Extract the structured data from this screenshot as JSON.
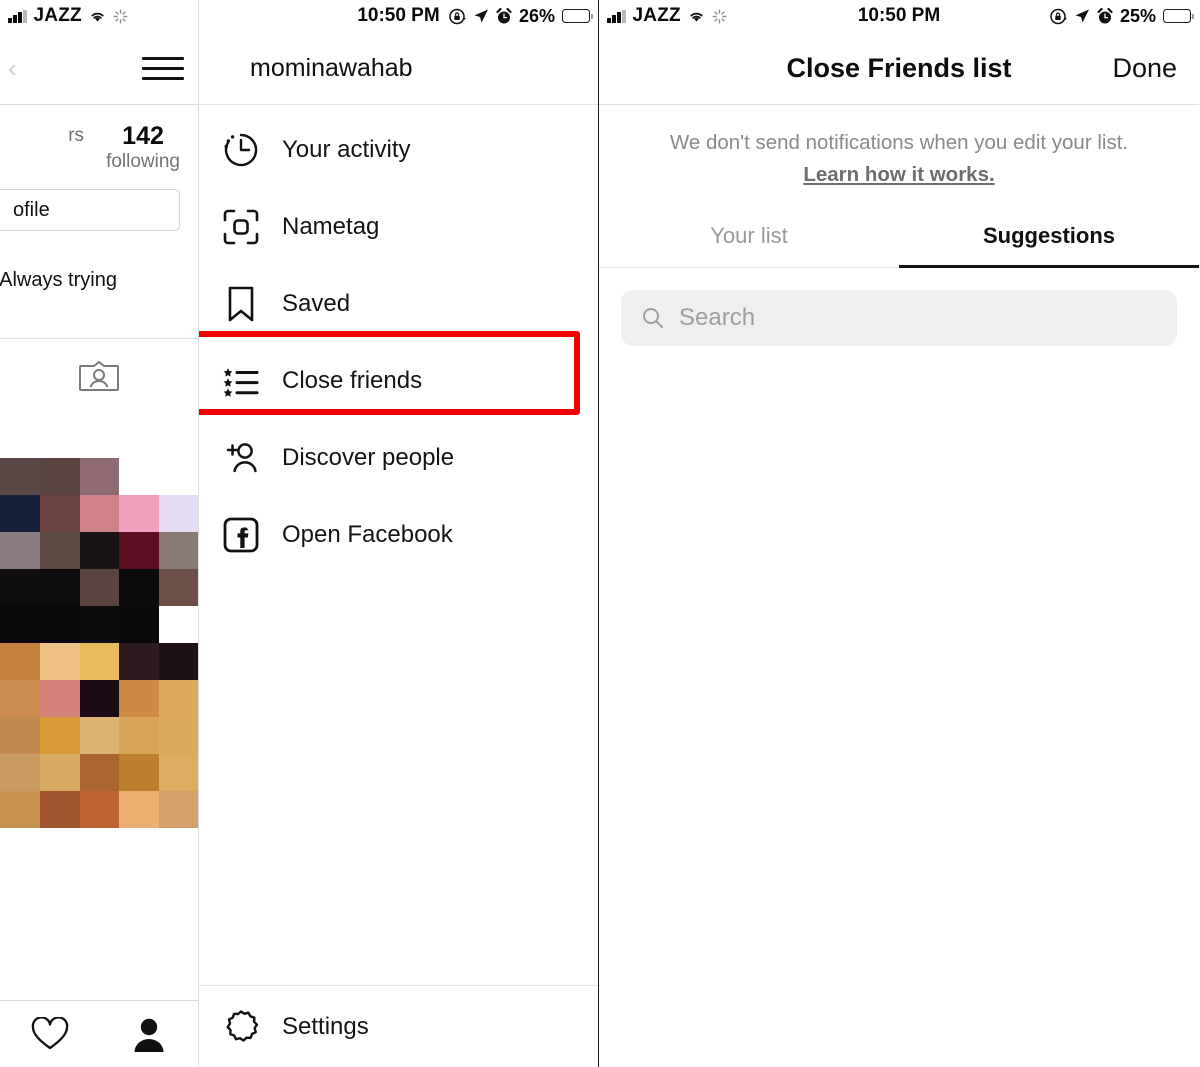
{
  "left_panel": {
    "status_bar": {
      "carrier": "JAZZ",
      "time": "10:50 PM",
      "battery_pct": "26%",
      "icons": [
        "signal-bars-icon",
        "wifi-icon",
        "sync-icon",
        "rotation-lock-icon",
        "location-arrow-icon",
        "alarm-icon",
        "battery-icon"
      ]
    },
    "nav": {
      "back_caret": "‹",
      "menu_icon": "hamburger-icon"
    },
    "stats": [
      {
        "number": "",
        "label": "rs"
      },
      {
        "number": "142",
        "label": "following"
      }
    ],
    "edit_profile_label": "ofile",
    "bio_text": "e. Always trying",
    "tag_icon": "nametag-card-icon",
    "bottom_nav": [
      "heart-icon",
      "profile-person-icon"
    ]
  },
  "middle_panel": {
    "status_bar": {
      "time": "10:50 PM",
      "battery_pct": "26%"
    },
    "username": "mominawahab",
    "menu_items": [
      {
        "label": "Your activity",
        "icon": "clock-activity-icon",
        "highlighted": false
      },
      {
        "label": "Nametag",
        "icon": "nametag-scan-icon",
        "highlighted": false
      },
      {
        "label": "Saved",
        "icon": "bookmark-icon",
        "highlighted": false
      },
      {
        "label": "Close friends",
        "icon": "star-list-icon",
        "highlighted": true
      },
      {
        "label": "Discover people",
        "icon": "add-person-icon",
        "highlighted": false
      },
      {
        "label": "Open Facebook",
        "icon": "facebook-icon",
        "highlighted": false
      }
    ],
    "settings": {
      "label": "Settings",
      "icon": "gear-icon"
    },
    "highlight_color": "#ee0000"
  },
  "right_panel": {
    "status_bar": {
      "carrier": "JAZZ",
      "time": "10:50 PM",
      "battery_pct": "25%"
    },
    "nav": {
      "title": "Close Friends list",
      "done_label": "Done"
    },
    "notice": {
      "text": "We don't send notifications when you edit your list. ",
      "link_text": "Learn how it works."
    },
    "tabs": [
      {
        "label": "Your list",
        "active": false
      },
      {
        "label": "Suggestions",
        "active": true
      }
    ],
    "search": {
      "placeholder": "Search",
      "icon": "search-icon"
    }
  }
}
